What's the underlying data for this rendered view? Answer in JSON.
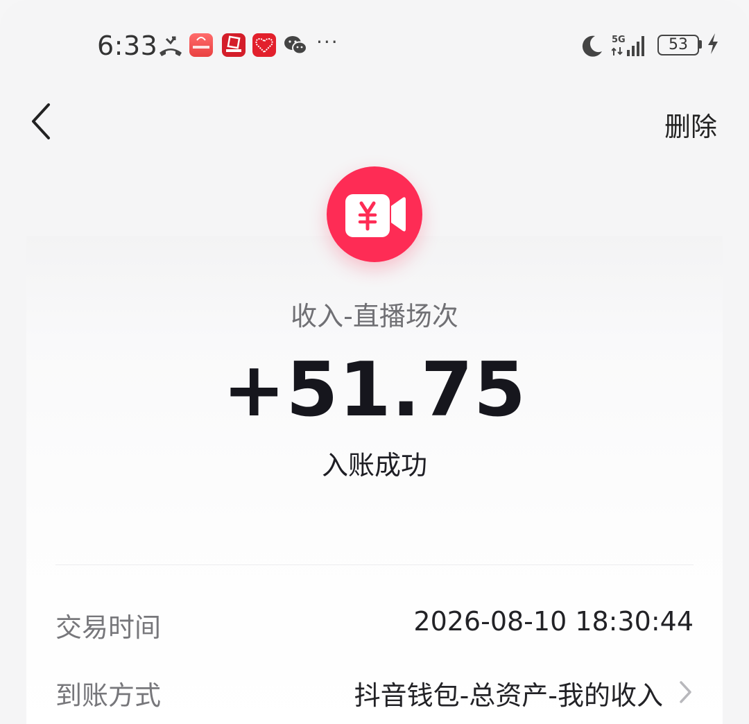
{
  "status_bar": {
    "time": "6:33",
    "battery": "53",
    "network": "5G",
    "icons": [
      "missed-call-icon",
      "huawei-app-icon",
      "securities-app-icon",
      "heart-app-icon",
      "wechat-icon",
      "more-dots-icon",
      "moon-icon",
      "signal-icon",
      "battery-icon",
      "charging-bolt-icon"
    ],
    "more": "···"
  },
  "nav": {
    "back_icon": "chevron-left-icon",
    "delete_label": "删除"
  },
  "transaction": {
    "icon": "video-yuan-icon",
    "icon_color": "#fe2c55",
    "category": "收入-直播场次",
    "amount": "+51.75",
    "status": "入账成功"
  },
  "details": [
    {
      "label": "交易时间",
      "value": "2026-08-10 18:30:44"
    },
    {
      "label": "到账方式",
      "value": "抖音钱包-总资产-我的收入",
      "chevron_icon": "chevron-right-icon"
    }
  ]
}
